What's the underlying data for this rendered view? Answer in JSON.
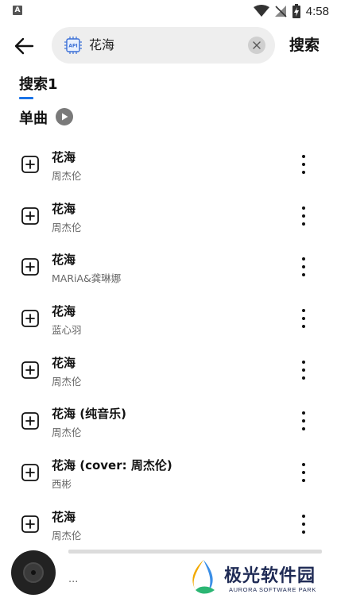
{
  "status_bar": {
    "time": "4:58",
    "left_icon": "A"
  },
  "header": {
    "search_value": "花海",
    "search_button": "搜索"
  },
  "tabs": [
    {
      "label": "搜索1",
      "active": true
    }
  ],
  "section": {
    "title": "单曲"
  },
  "songs": [
    {
      "title": "花海",
      "artist": "周杰伦"
    },
    {
      "title": "花海",
      "artist": "周杰伦"
    },
    {
      "title": "花海",
      "artist": "MARiA&龚琳娜"
    },
    {
      "title": "花海",
      "artist": "蓝心羽"
    },
    {
      "title": "花海",
      "artist": "周杰伦"
    },
    {
      "title": "花海 (纯音乐)",
      "artist": "周杰伦"
    },
    {
      "title": "花海 (cover: 周杰伦)",
      "artist": "西彬"
    },
    {
      "title": "花海",
      "artist": "周杰伦"
    }
  ],
  "player": {
    "text": "..."
  },
  "watermark": {
    "title": "极光软件园",
    "subtitle": "AURORA SOFTWARE PARK"
  },
  "colors": {
    "accent": "#1a73e8",
    "search_bg": "#eeeeee",
    "watermark": "#1f2b55"
  }
}
